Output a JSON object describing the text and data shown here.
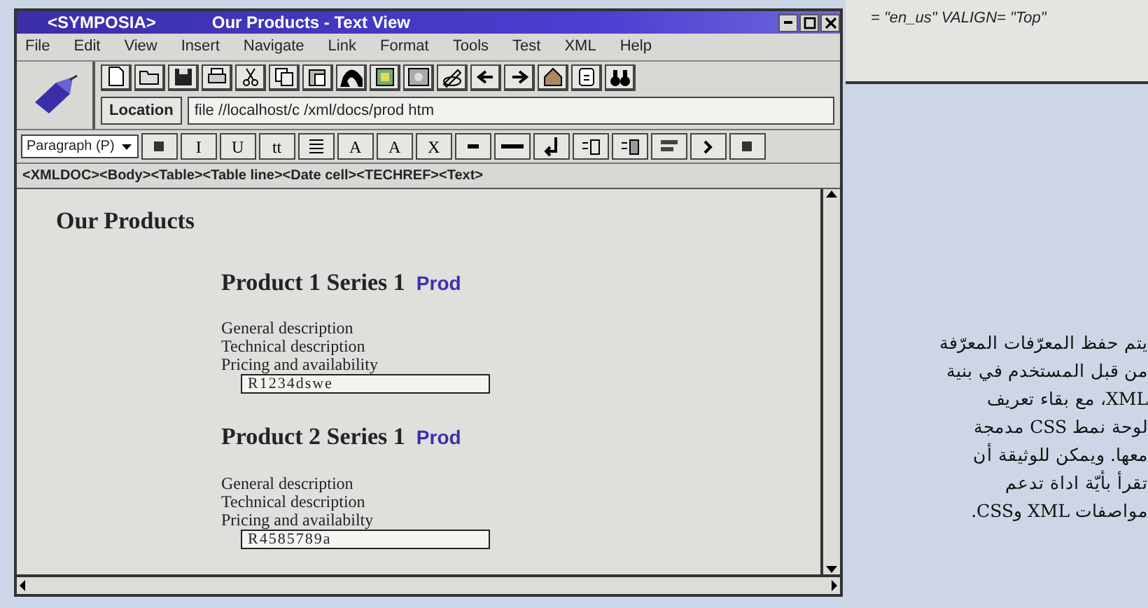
{
  "back_window": {
    "code_text": "= \"en_us\" VALIGN= \"Top\""
  },
  "window": {
    "title_left": "<SYMPOSIA>",
    "title": "Our Products - Text View"
  },
  "menu": [
    "File",
    "Edit",
    "View",
    "Insert",
    "Navigate",
    "Link",
    "Format",
    "Tools",
    "Test",
    "XML",
    "Help"
  ],
  "location": {
    "label": "Location",
    "value": "file //localhost/c /xml/docs/prod htm"
  },
  "format_toolbar": {
    "style_select": "Paragraph (P)",
    "buttons": [
      {
        "kind": "icon"
      },
      {
        "kind": "text",
        "label": "I"
      },
      {
        "kind": "text",
        "label": "U"
      },
      {
        "kind": "text",
        "label": "tt"
      },
      {
        "kind": "icon"
      },
      {
        "kind": "text",
        "label": "A"
      },
      {
        "kind": "text",
        "label": "A"
      },
      {
        "kind": "text",
        "label": "X"
      },
      {
        "kind": "icon"
      },
      {
        "kind": "icon"
      },
      {
        "kind": "icon"
      },
      {
        "kind": "icon"
      },
      {
        "kind": "icon"
      },
      {
        "kind": "icon"
      },
      {
        "kind": "icon"
      },
      {
        "kind": "icon"
      }
    ]
  },
  "tag_path": "<XMLDOC><Body><Table><Table line><Date cell><TECHREF><Text>",
  "document": {
    "heading": "Our Products",
    "products": [
      {
        "title": "Product 1 Series 1",
        "link": "Prod",
        "lines": [
          "General description",
          "Technical description",
          "Pricing and availability"
        ],
        "code": "R1234dswe"
      },
      {
        "title": "Product 2 Series 1",
        "link": "Prod",
        "lines": [
          "General description",
          "Technical description",
          "Pricing and availabilty"
        ],
        "code": "R4585789a"
      }
    ]
  },
  "caption": [
    "يتم حفظ المعرّفات المعرّفة",
    "من قبل المستخدم في بنية",
    "XML، مع بقاء تعريف",
    "لوحة نمط CSS مدمجة",
    "معها. ويمكن للوثيقة أن",
    "تقرأ بأيّة اداة تدعم",
    "مواصفات XML وCSS."
  ]
}
